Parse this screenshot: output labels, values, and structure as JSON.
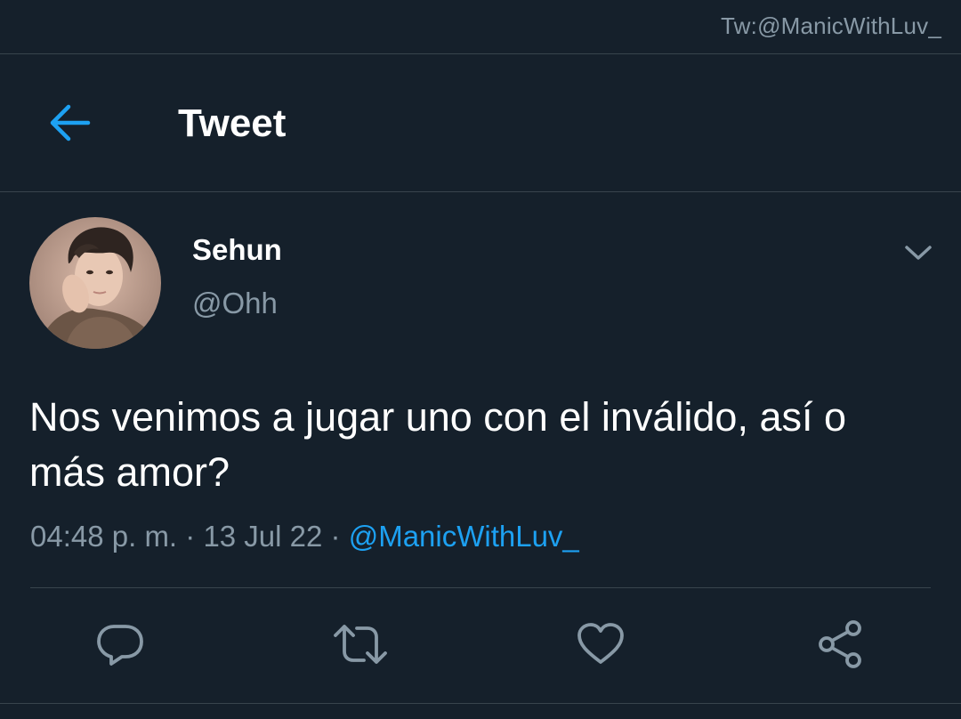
{
  "watermark": "Tw:@ManicWithLuv_",
  "header": {
    "title": "Tweet",
    "back_icon": "arrow-left-icon",
    "accent_color": "#1da1f2"
  },
  "tweet": {
    "author": {
      "display_name": "Sehun",
      "username": "@Ohh"
    },
    "text": "Nos venimos a jugar uno con el inválido, así o más amor?",
    "time": "04:48 p. m.",
    "date": "13 Jul 22",
    "separator": " · ",
    "source": "@ManicWithLuv_"
  },
  "actions": [
    {
      "name": "reply",
      "icon": "comment-icon"
    },
    {
      "name": "retweet",
      "icon": "retweet-icon"
    },
    {
      "name": "like",
      "icon": "heart-icon"
    },
    {
      "name": "share",
      "icon": "share-icon"
    }
  ],
  "colors": {
    "background": "#15202b",
    "divider": "#38444d",
    "secondary_text": "#8899a6",
    "primary_text": "#ffffff",
    "link": "#1da1f2"
  }
}
